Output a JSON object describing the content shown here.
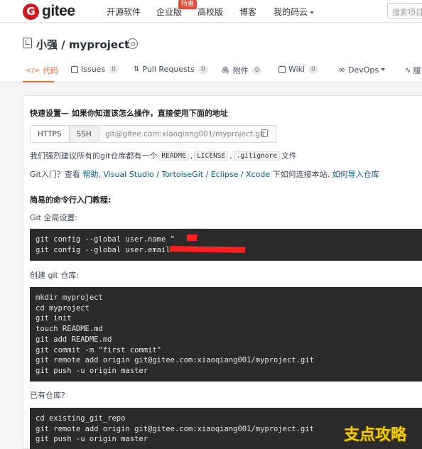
{
  "header": {
    "logo_text": "gitee",
    "nav": [
      "开源软件",
      "企业版",
      "高校版",
      "博客",
      "我的码云"
    ],
    "enterprise_badge": "特惠",
    "search_placeholder": "搜索项目"
  },
  "repo": {
    "title": "小强 / myproject"
  },
  "tabs": [
    {
      "label": "代码",
      "count": ""
    },
    {
      "label": "Issues",
      "count": "0"
    },
    {
      "label": "Pull Requests",
      "count": "0"
    },
    {
      "label": "附件",
      "count": "0"
    },
    {
      "label": "Wiki",
      "count": "0"
    },
    {
      "label": "DevOps",
      "count": ""
    },
    {
      "label": "服",
      "count": ""
    }
  ],
  "quick_setup": {
    "heading": "快速设置— 如果你知道该怎么操作，直接使用下面的地址",
    "protocol_https": "HTTPS",
    "protocol_ssh": "SSH",
    "clone_url": "git@gitee.com:xiaoqiang001/myproject.git",
    "recommend_prefix": "我们强烈建议所有的git仓库都有一个",
    "recommend_files": [
      "README",
      "LICENSE",
      ".gitignore"
    ],
    "recommend_suffix": "文件",
    "intro_prefix": "Git入门？查看",
    "intro_help": "帮助",
    "intro_clients": ", Visual Studio / TortoiseGit / Eclipse / Xcode",
    "intro_connect": "下如何连接本站,",
    "intro_import": "如何导入仓库"
  },
  "tutorial": {
    "heading": "简易的命令行入门教程:",
    "global_label": "Git 全局设置:",
    "global_lines": [
      "git config --global user.name \"",
      "git config --global user.email \""
    ],
    "create_label": "创建 git 仓库:",
    "create_lines": [
      "mkdir myproject",
      "cd myproject",
      "git init",
      "touch README.md",
      "git add README.md",
      "git commit -m \"first commit\"",
      "git remote add origin git@gitee.com:xiaoqiang001/myproject.git",
      "git push -u origin master"
    ],
    "existing_label": "已有仓库?",
    "existing_lines": [
      "cd existing_git_repo",
      "git remote add origin git@gitee.com:xiaoqiang001/myproject.git",
      "git push -u origin master"
    ]
  },
  "watermark": "支点攻略",
  "colors": {
    "brand": "#c71d23",
    "accent": "#e76f34",
    "link": "#005980",
    "terminal": "#2b2b2b"
  }
}
